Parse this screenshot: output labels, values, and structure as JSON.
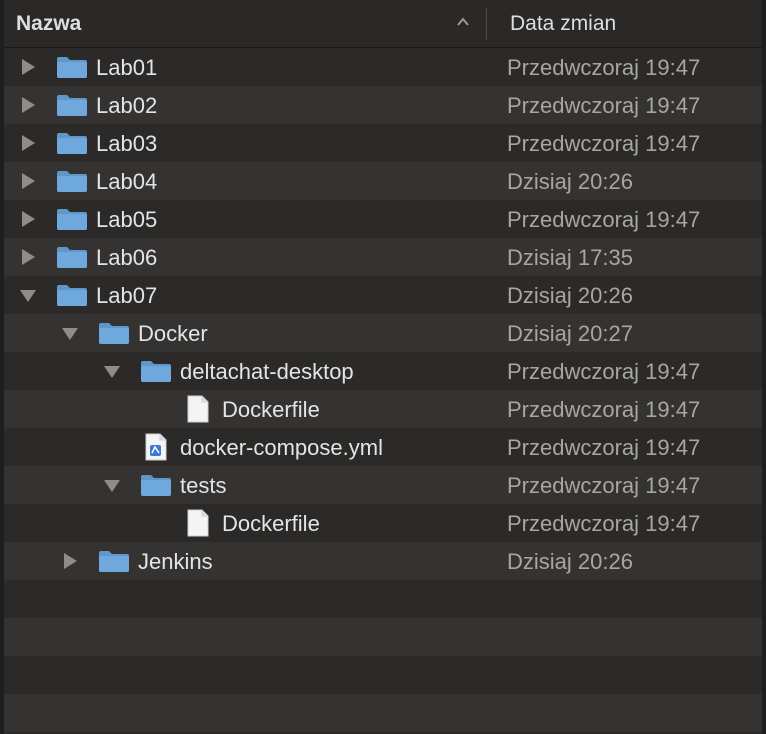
{
  "header": {
    "name_label": "Nazwa",
    "date_label": "Data zmian"
  },
  "rows": [
    {
      "name": "Lab01",
      "date": "Przedwczoraj 19:47",
      "kind": "folder",
      "depth": 0,
      "expanded": false
    },
    {
      "name": "Lab02",
      "date": "Przedwczoraj 19:47",
      "kind": "folder",
      "depth": 0,
      "expanded": false
    },
    {
      "name": "Lab03",
      "date": "Przedwczoraj 19:47",
      "kind": "folder",
      "depth": 0,
      "expanded": false
    },
    {
      "name": "Lab04",
      "date": "Dzisiaj 20:26",
      "kind": "folder",
      "depth": 0,
      "expanded": false
    },
    {
      "name": "Lab05",
      "date": "Przedwczoraj 19:47",
      "kind": "folder",
      "depth": 0,
      "expanded": false
    },
    {
      "name": "Lab06",
      "date": "Dzisiaj 17:35",
      "kind": "folder",
      "depth": 0,
      "expanded": false
    },
    {
      "name": "Lab07",
      "date": "Dzisiaj 20:26",
      "kind": "folder",
      "depth": 0,
      "expanded": true
    },
    {
      "name": "Docker",
      "date": "Dzisiaj 20:27",
      "kind": "folder",
      "depth": 1,
      "expanded": true
    },
    {
      "name": "deltachat-desktop",
      "date": "Przedwczoraj 19:47",
      "kind": "folder",
      "depth": 2,
      "expanded": true
    },
    {
      "name": "Dockerfile",
      "date": "Przedwczoraj 19:47",
      "kind": "file",
      "depth": 3
    },
    {
      "name": "docker-compose.yml",
      "date": "Przedwczoraj 19:47",
      "kind": "yml",
      "depth": 2
    },
    {
      "name": "tests",
      "date": "Przedwczoraj 19:47",
      "kind": "folder",
      "depth": 2,
      "expanded": true
    },
    {
      "name": "Dockerfile",
      "date": "Przedwczoraj 19:47",
      "kind": "file",
      "depth": 3
    },
    {
      "name": "Jenkins",
      "date": "Dzisiaj 20:26",
      "kind": "folder",
      "depth": 1,
      "expanded": false
    }
  ],
  "colors": {
    "folder": "#6fa8dc",
    "row_even": "#2b2a29",
    "row_odd": "#353331",
    "text": "#e4e4e4",
    "date_text": "#a7a6a5"
  }
}
